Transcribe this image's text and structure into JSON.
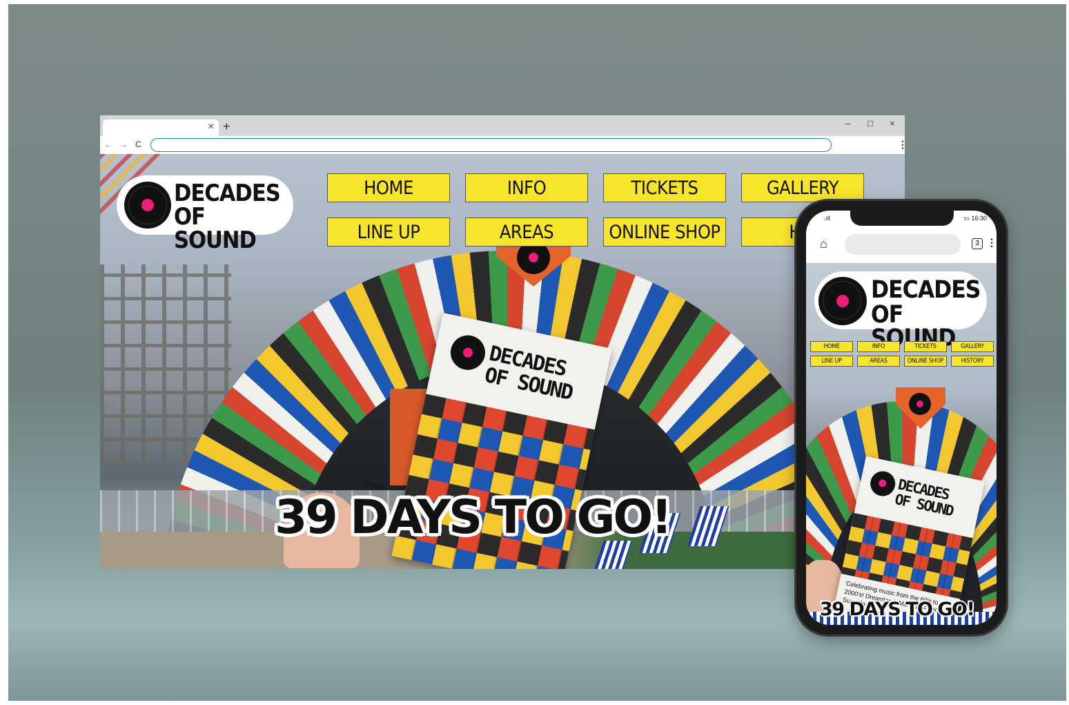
{
  "browser": {
    "tab_close": "×",
    "new_tab": "+",
    "minimize": "–",
    "maximize": "□",
    "close": "×",
    "back": "←",
    "forward": "→",
    "reload": "C",
    "menu": "⋮",
    "url": ""
  },
  "site": {
    "logo_line1": "DECADES",
    "logo_line2": "OF SOUND",
    "nav": [
      "HOME",
      "INFO",
      "TICKETS",
      "GALLERY",
      "LINE UP",
      "AREAS",
      "ONLINE SHOP",
      "HIS"
    ],
    "countdown": "39 DAYS TO GO!",
    "flyer_line1": "DECADES",
    "flyer_line2": "OF SOUND",
    "flyer_text": "Celeb"
  },
  "phone": {
    "signal": ".ıll",
    "battery": "▭ 16:30",
    "home": "⌂",
    "tabs_count": "3",
    "menu": "⋮",
    "logo_line1": "DECADES",
    "logo_line2": "OF SOUND",
    "nav": [
      "HOME",
      "INFO",
      "TICKETS",
      "GALLERY",
      "LINE UP",
      "AREAS",
      "ONLINE SHOP",
      "HISTORY"
    ],
    "flyer_line1": "DECADES",
    "flyer_line2": "OF SOUND",
    "flyer_text": "Celebrating music from the 60's to 2000's! Dreamland, Margate Fri 20th- Sun 22nd",
    "countdown": "39 DAYS TO GO!"
  },
  "colors": {
    "nav_yellow": "#f7e52c",
    "record_pink": "#ec1e79",
    "stage_orange": "#e4642a",
    "url_border": "#1d8ca2"
  }
}
